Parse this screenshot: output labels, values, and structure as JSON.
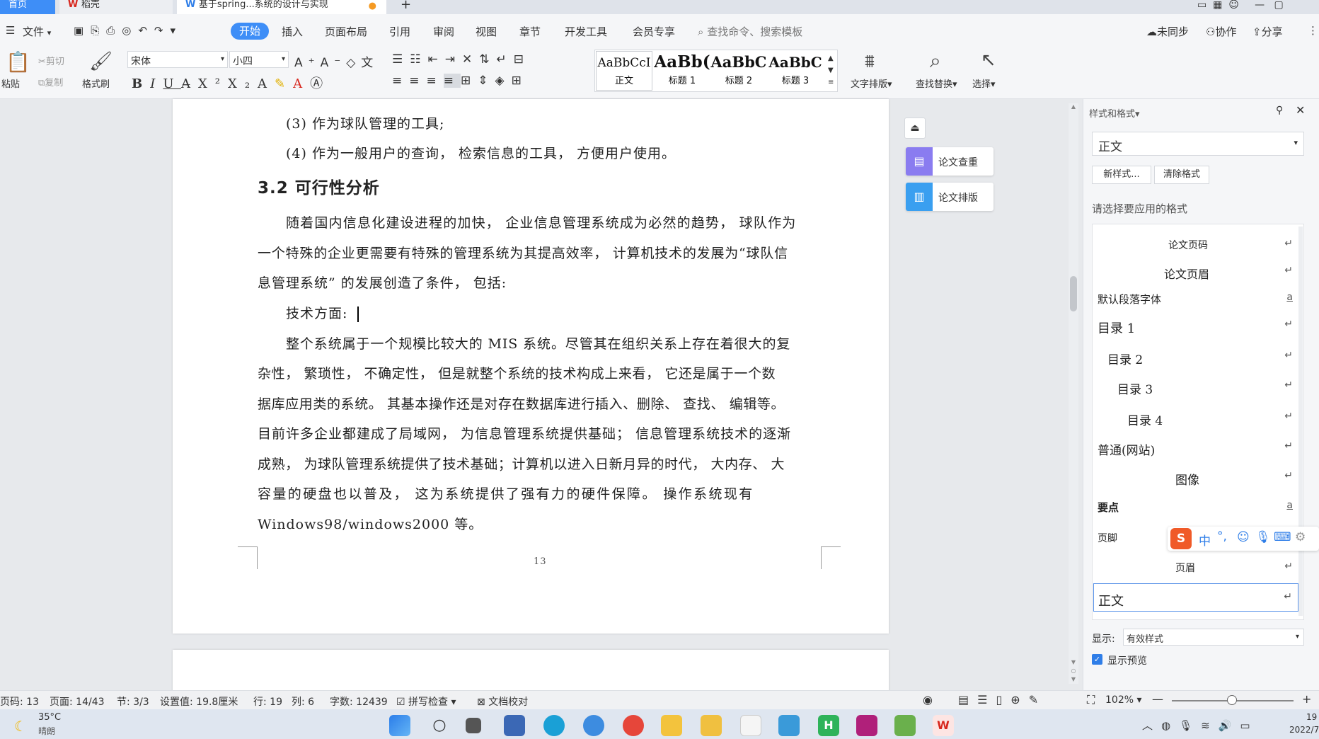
{
  "tabs": [
    "首页",
    "稻壳",
    "基于spring...系统的设计与实现"
  ],
  "menu": {
    "file": "文件",
    "items": [
      "开始",
      "插入",
      "页面布局",
      "引用",
      "审阅",
      "视图",
      "章节",
      "开发工具",
      "会员专享"
    ],
    "search_placeholder": "查找命令、搜索模板",
    "sync": "未同步",
    "collab": "协作",
    "share": "分享"
  },
  "ribbon": {
    "paste": "粘贴",
    "cut": "剪切",
    "copy": "复制",
    "format_painter": "格式刷",
    "font": "宋体",
    "size": "小四",
    "styles": [
      {
        "preview": "AaBbCcI",
        "name": "正文"
      },
      {
        "preview": "AaBb(",
        "name": "标题 1"
      },
      {
        "preview": "AaBbC",
        "name": "标题 2"
      },
      {
        "preview": "AaBbC",
        "name": "标题 3"
      }
    ],
    "text_layout": "文字排版",
    "find_replace": "查找替换",
    "select": "选择"
  },
  "doc": {
    "lines": [
      "(3) 作为球队管理的工具;",
      "(4) 作为一般用户的查询， 检索信息的工具， 方便用户使用。",
      "3.2  可行性分析",
      "随着国内信息化建设进程的加快， 企业信息管理系统成为必然的趋势， 球队作为",
      "一个特殊的企业更需要有特殊的管理系统为其提高效率， 计算机技术的发展为“球队信",
      "息管理系统” 的发展创造了条件， 包括:",
      "技术方面:",
      "整个系统属于一个规模比较大的 MIS 系统。尽管其在组织关系上存在着很大的复",
      "杂性， 繁琐性， 不确定性， 但是就整个系统的技术构成上来看， 它还是属于一个数",
      "据库应用类的系统。 其基本操作还是对存在数据库进行插入、删除、 查找、 编辑等。",
      "目前许多企业都建成了局域网， 为信息管理系统提供基础； 信息管理系统技术的逐渐",
      "成熟， 为球队管理系统提供了技术基础；计算机以进入日新月异的时代， 大内存、 大",
      "容量的硬盘也以普及， 这为系统提供了强有力的硬件保障。 操作系统现有",
      "Windows98/windows2000 等。"
    ],
    "page_number": "13"
  },
  "float_buttons": [
    "论文查重",
    "论文排版"
  ],
  "panel": {
    "title": "样式和格式",
    "current_style": "正文",
    "new_style": "新样式...",
    "clear_format": "清除格式",
    "prompt": "请选择要应用的格式",
    "styles": [
      {
        "name": "论文页码",
        "mark": "↵"
      },
      {
        "name": "论文页眉",
        "mark": "↵"
      },
      {
        "name": "默认段落字体",
        "mark": "a"
      },
      {
        "name": "目录 1",
        "mark": "↵"
      },
      {
        "name": "目录 2",
        "mark": "↵"
      },
      {
        "name": "目录 3",
        "mark": "↵"
      },
      {
        "name": "目录 4",
        "mark": "↵"
      },
      {
        "name": "普通(网站)",
        "mark": "↵"
      },
      {
        "name": "图像",
        "mark": "↵"
      },
      {
        "name": "要点",
        "mark": "a"
      },
      {
        "name": "页脚",
        "mark": "↵"
      },
      {
        "name": "页眉",
        "mark": "↵"
      },
      {
        "name": "正文",
        "mark": "↵"
      }
    ],
    "show_label": "显示:",
    "show_value": "有效样式",
    "preview_label": "显示预览"
  },
  "ime": {
    "mode": "中"
  },
  "status": {
    "page_code": "页码: 13",
    "page": "页面: 14/43",
    "section": "节: 3/3",
    "setting": "设置值: 19.8厘米",
    "row": "行: 19",
    "col": "列: 6",
    "words": "字数: 12439",
    "spell": "拼写检查",
    "proof": "文档校对",
    "zoom": "102%"
  },
  "taskbar": {
    "temp": "35°C",
    "weather": "晴朗",
    "time": "19",
    "date": "2022/7"
  },
  "colors": {
    "accent": "#2f7ee8",
    "brand_red": "#d7261d"
  }
}
